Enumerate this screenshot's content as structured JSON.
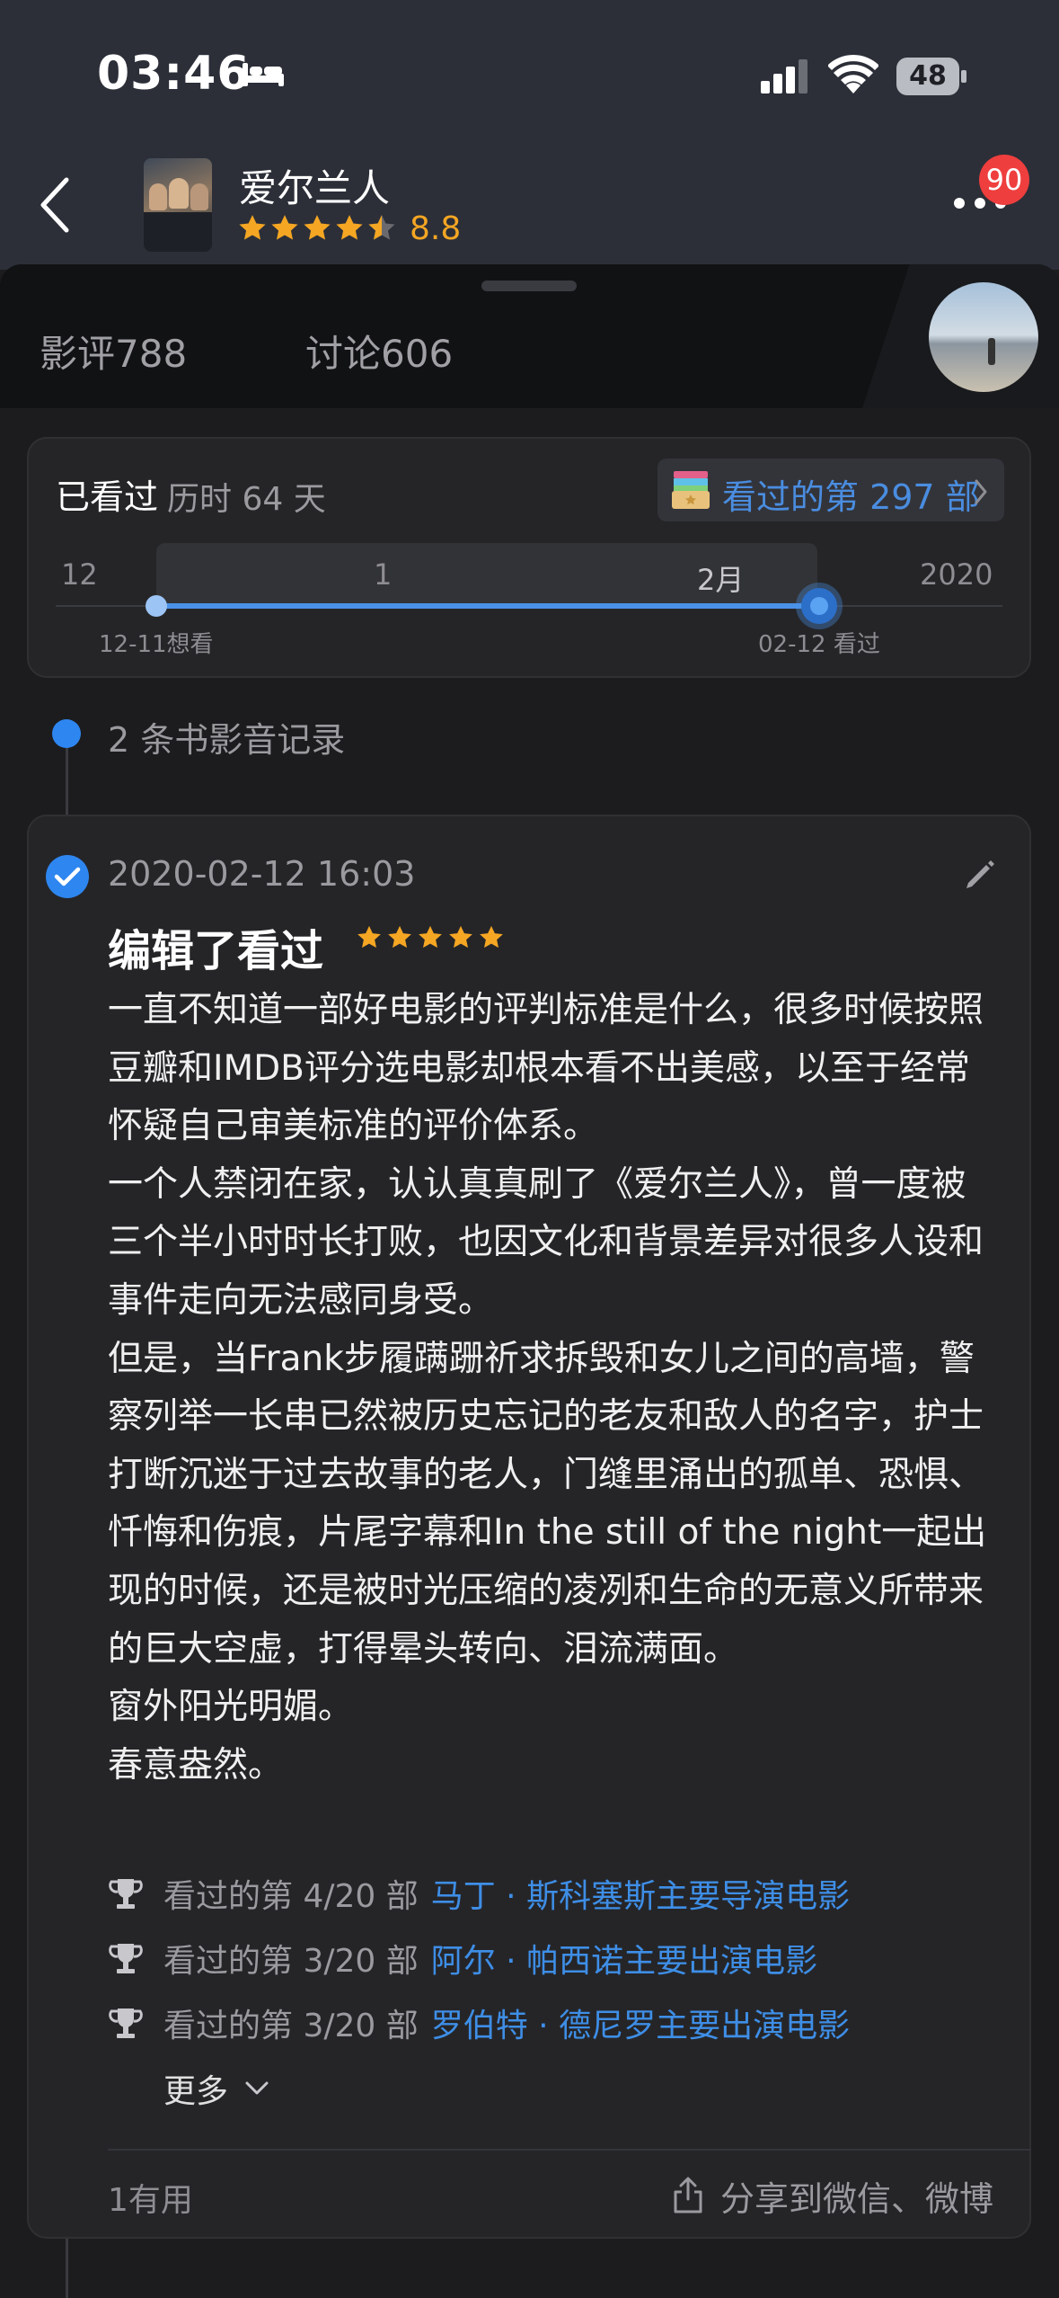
{
  "status_bar": {
    "time": "03:46",
    "battery": "48",
    "icons": [
      "bed-icon",
      "signal-icon",
      "wifi-icon",
      "battery-icon"
    ]
  },
  "header": {
    "title": "爱尔兰人",
    "rating": "8.8",
    "star_rating_fraction": 0.88,
    "notification_count": "90"
  },
  "tabs": [
    {
      "label": "影评788"
    },
    {
      "label": "讨论606"
    }
  ],
  "watched": {
    "label": "已看过",
    "duration": "历时 64 天",
    "count_text": "看过的第 297 部",
    "timeline": {
      "months": [
        "12",
        "1",
        "2月",
        "2020"
      ],
      "start_caption": "12-11想看",
      "end_caption": "02-12 看过"
    }
  },
  "records": {
    "count_text": "2 条书影音记录"
  },
  "review": {
    "date": "2020-02-12 16:03",
    "action": "编辑了看过",
    "stars": 5,
    "body": "一直不知道一部好电影的评判标准是什么，很多时候按照豆瓣和IMDB评分选电影却根本看不出美感，以至于经常怀疑自己审美标准的评价体系。\n一个人禁闭在家，认认真真刷了《爱尔兰人》，曾一度被三个半小时时长打败，也因文化和背景差异对很多人设和事件走向无法感同身受。\n但是，当Frank步履蹒跚祈求拆毁和女儿之间的高墙，警察列举一长串已然被历史忘记的老友和敌人的名字，护士打断沉迷于过去故事的老人，门缝里涌出的孤单、恐惧、忏悔和伤痕，片尾字幕和In the still of the night一起出现的时候，还是被时光压缩的凌冽和生命的无意义所带来的巨大空虚，打得晕头转向、泪流满面。\n窗外阳光明媚。\n春意盎然。",
    "achievements": [
      {
        "prefix": "看过的第 4/20 部",
        "link": "马丁 · 斯科塞斯主要导演电影"
      },
      {
        "prefix": "看过的第 3/20 部",
        "link": "阿尔 · 帕西诺主要出演电影"
      },
      {
        "prefix": "看过的第 3/20 部",
        "link": "罗伯特 · 德尼罗主要出演电影"
      }
    ],
    "more_label": "更多",
    "useful": "1有用",
    "share_label": "分享到微信、微博"
  },
  "colors": {
    "accent_blue": "#3e8ee6",
    "star_orange": "#f5a623",
    "badge_red": "#ef3e3e",
    "background": "#1c1c1e",
    "card": "#252528"
  }
}
